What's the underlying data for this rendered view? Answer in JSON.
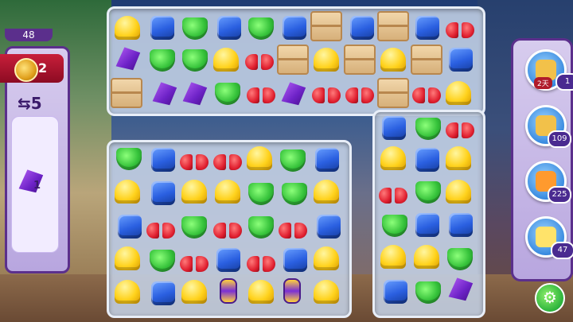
{
  "level": {
    "number": "48"
  },
  "goal_panel": {
    "badge_count": "2",
    "moves_label": "⇆5",
    "goal_item": {
      "icon": "rocket-kite-icon",
      "count": "1"
    }
  },
  "boosters": [
    {
      "icon": "hammer-clock-icon",
      "count": "1",
      "timer": "2天"
    },
    {
      "icon": "hammer-icon",
      "count": "109"
    },
    {
      "icon": "glove-icon",
      "count": "225"
    },
    {
      "icon": "golden-soap-icon",
      "count": "47"
    }
  ],
  "settings": {
    "icon": "gear-icon"
  },
  "colors": {
    "accent_purple": "#5b2f8c",
    "badge_red": "#c81f3a",
    "settings_green": "#2bb33c"
  }
}
